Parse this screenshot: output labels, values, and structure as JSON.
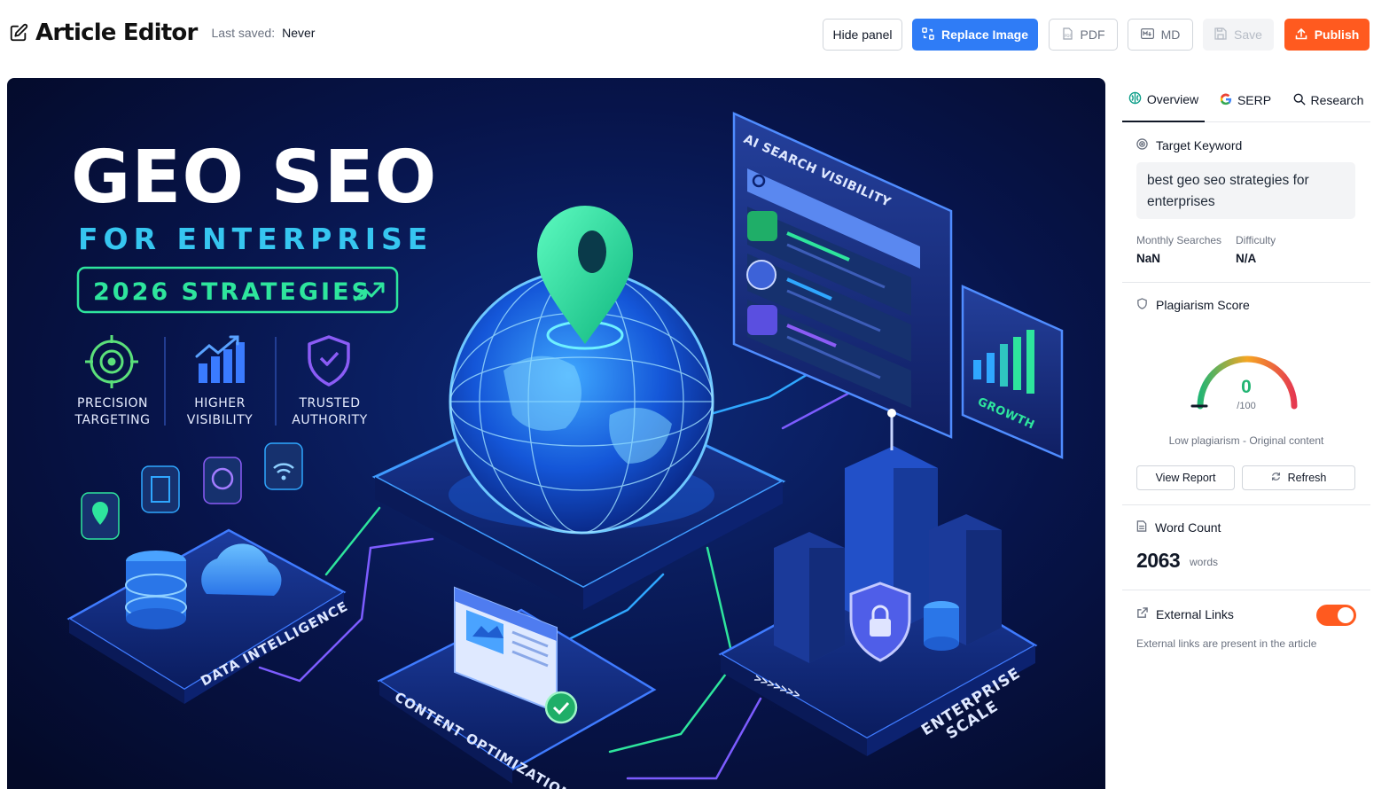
{
  "header": {
    "title": "Article Editor",
    "last_saved_label": "Last saved:",
    "last_saved_value": "Never"
  },
  "toolbar": {
    "hide_panel": "Hide panel",
    "replace_image": "Replace Image",
    "pdf": "PDF",
    "md": "MD",
    "save": "Save",
    "publish": "Publish"
  },
  "hero": {
    "title_line1": "GEO SEO",
    "title_line2": "FOR ENTERPRISE",
    "badge": "2026 STRATEGIES",
    "features": [
      {
        "line1": "PRECISION",
        "line2": "TARGETING",
        "icon": "target-icon"
      },
      {
        "line1": "HIGHER",
        "line2": "VISIBILITY",
        "icon": "bar-chart-icon"
      },
      {
        "line1": "TRUSTED",
        "line2": "AUTHORITY",
        "icon": "shield-check-icon"
      }
    ],
    "labels": {
      "ai_search": "AI SEARCH VISIBILITY",
      "growth": "GROWTH",
      "data_intelligence": "DATA INTELLIGENCE",
      "content_optimization": "CONTENT OPTIMIZATION",
      "enterprise": "ENTERPRISE",
      "scale": "SCALE",
      "arrows": ">>>>>>>"
    },
    "colors": {
      "background": "#061035",
      "accent_green": "#2ee59d",
      "accent_blue": "#2fa7ff",
      "accent_purple": "#8b5cf6"
    }
  },
  "panel": {
    "tabs": [
      {
        "label": "Overview",
        "icon": "brain-icon",
        "active": true
      },
      {
        "label": "SERP",
        "icon": "google-icon",
        "active": false
      },
      {
        "label": "Research",
        "icon": "search-icon",
        "active": false
      }
    ],
    "target_keyword": {
      "title": "Target Keyword",
      "value": "best geo seo strategies for enterprises",
      "monthly_searches_label": "Monthly Searches",
      "monthly_searches_value": "NaN",
      "difficulty_label": "Difficulty",
      "difficulty_value": "N/A"
    },
    "plagiarism": {
      "title": "Plagiarism Score",
      "score": "0",
      "max": "/100",
      "score_fraction": 0,
      "caption": "Low plagiarism - Original content",
      "view_report": "View Report",
      "refresh": "Refresh"
    },
    "word_count": {
      "title": "Word Count",
      "value": "2063",
      "unit": "words"
    },
    "external_links": {
      "title": "External Links",
      "enabled": true,
      "caption": "External links are present in the article"
    }
  }
}
